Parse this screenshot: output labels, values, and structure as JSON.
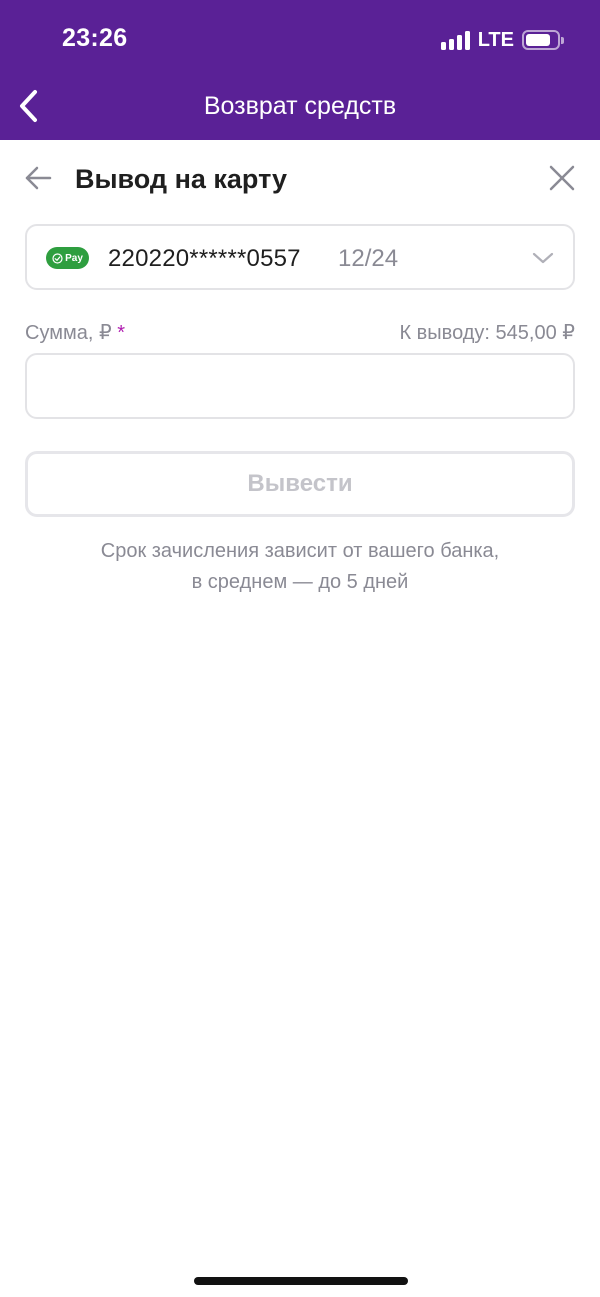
{
  "status_bar": {
    "time": "23:26",
    "network": "LTE"
  },
  "nav": {
    "title": "Возврат средств",
    "back_icon": "chevron-left-icon"
  },
  "sheet": {
    "title": "Вывод на карту",
    "back_icon": "arrow-left-icon",
    "close_icon": "close-icon"
  },
  "card": {
    "badge_label": "Pay",
    "number": "220220******0557",
    "expiry": "12/24",
    "badge_color": "#2e9e3f"
  },
  "amount": {
    "label": "Сумма, ₽",
    "required_mark": "*",
    "available": "К выводу: 545,00 ₽",
    "value": ""
  },
  "withdraw_button": {
    "label": "Вывести"
  },
  "info": {
    "line1": "Срок зачисления зависит от вашего банка,",
    "line2": "в среднем — до 5 дней"
  },
  "colors": {
    "accent": "#5a2196",
    "required": "#b01eb0"
  }
}
